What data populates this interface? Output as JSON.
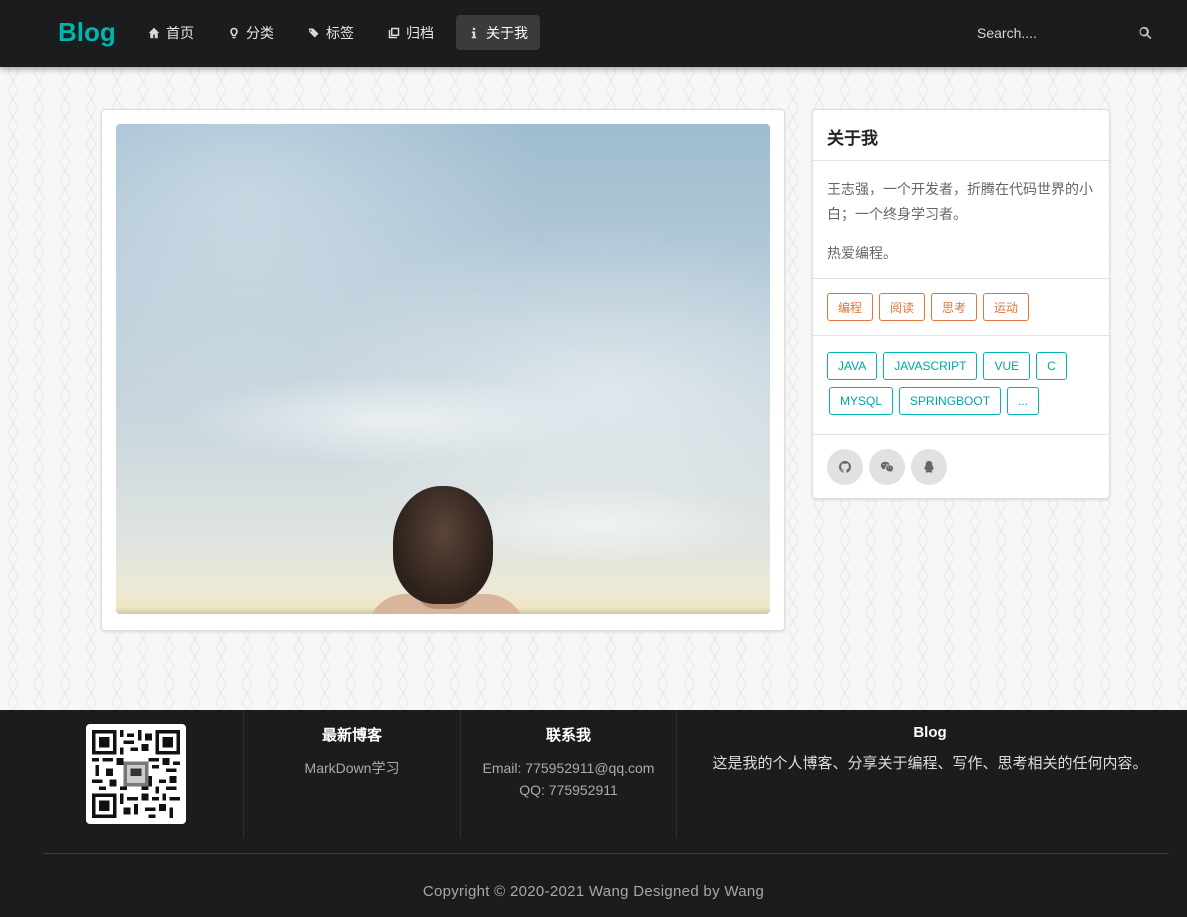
{
  "nav": {
    "brand": "Blog",
    "items": [
      {
        "label": "首页",
        "icon": "home-icon"
      },
      {
        "label": "分类",
        "icon": "idea-icon"
      },
      {
        "label": "标签",
        "icon": "tags-icon"
      },
      {
        "label": "归档",
        "icon": "clone-icon"
      },
      {
        "label": "关于我",
        "icon": "info-icon"
      }
    ],
    "search_placeholder": "Search....",
    "active": "关于我"
  },
  "about": {
    "title": "关于我",
    "intro": "王志强，一个开发者，折腾在代码世界的小白；一个终身学习者。",
    "love": "热爱编程。",
    "hobbies": [
      "编程",
      "阅读",
      "思考",
      "运动"
    ],
    "skills": [
      "JAVA",
      "JAVASCRIPT",
      "VUE",
      "C",
      "MYSQL",
      "SPRINGBOOT",
      "..."
    ],
    "social": [
      "github-icon",
      "wechat-icon",
      "qq-icon"
    ]
  },
  "footer": {
    "latest_title": "最新博客",
    "latest_items": [
      "MarkDown学习"
    ],
    "contact_title": "联系我",
    "email": "Email: 775952911@qq.com",
    "qq": "QQ: 775952911",
    "blog_title": "Blog",
    "blog_desc": "这是我的个人博客、分享关于编程、写作、思考相关的任何内容。",
    "copyright": "Copyright © 2020-2021 Wang Designed by Wang"
  },
  "colors": {
    "accent": "#00b5ad",
    "hobby": "#e0763c",
    "nav_bg": "#1b1c1d"
  }
}
